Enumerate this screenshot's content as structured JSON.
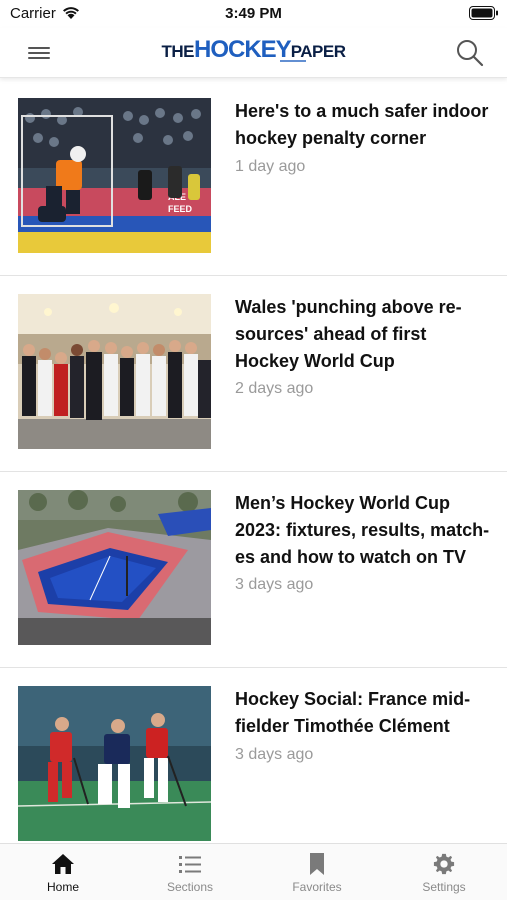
{
  "status_bar": {
    "carrier": "Carrier",
    "time": "3:49 PM"
  },
  "header": {
    "logo": {
      "part1": "THE",
      "part2": "HOCKEY",
      "part3": "PAPER"
    },
    "menu_icon": "hamburger-menu-icon",
    "search_icon": "search-icon"
  },
  "articles": [
    {
      "title": "Here's to a much safer indoor hockey penalty corner",
      "time": "1 day ago",
      "image": "indoor hockey goalkeeper saving a penalty corner"
    },
    {
      "title": "Wales 'punching above re-sources' ahead of first Hockey World Cup",
      "time": "2 days ago",
      "image": "Wales hockey squad group photo in a hall"
    },
    {
      "title": "Men’s Hockey World Cup 2023: fixtures, results, match-es and how to watch on TV",
      "time": "3 days ago",
      "image": "aerial view of a blue hockey stadium"
    },
    {
      "title": "Hockey Social: France mid-fielder Timothée Clément",
      "time": "3 days ago",
      "image": "field hockey players in action"
    }
  ],
  "tab_bar": {
    "tabs": [
      {
        "label": "Home",
        "icon": "home-icon",
        "active": true
      },
      {
        "label": "Sections",
        "icon": "list-icon",
        "active": false
      },
      {
        "label": "Favorites",
        "icon": "bookmark-icon",
        "active": false
      },
      {
        "label": "Settings",
        "icon": "gear-icon",
        "active": false
      }
    ]
  },
  "colors": {
    "logo_dark": "#0a1f45",
    "logo_blue": "#1f5fbf",
    "meta_text": "#9a9a9a",
    "tab_active": "#111111",
    "tab_inactive": "#8a8a8a"
  }
}
